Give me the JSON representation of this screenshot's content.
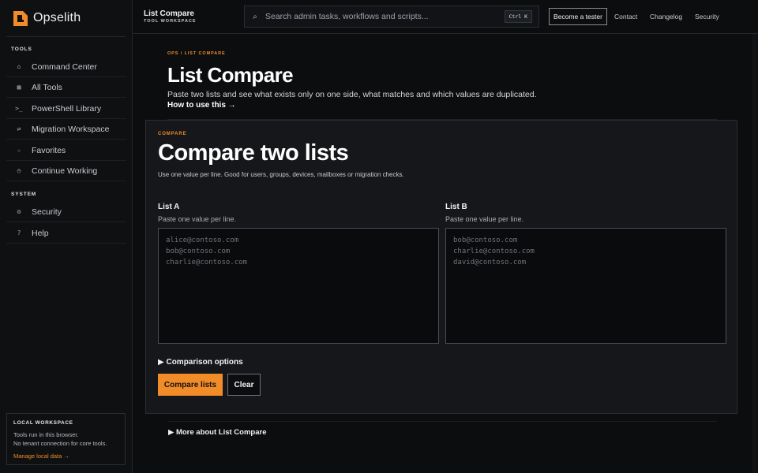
{
  "brand": {
    "name": "Opselith"
  },
  "sidebar": {
    "tools_label": "TOOLS",
    "tools": [
      {
        "icon": "⌂",
        "label": "Command Center"
      },
      {
        "icon": "▦",
        "label": "All Tools"
      },
      {
        "icon": ">_",
        "label": "PowerShell Library"
      },
      {
        "icon": "⇄",
        "label": "Migration Workspace"
      },
      {
        "icon": "☆",
        "label": "Favorites"
      },
      {
        "icon": "◷",
        "label": "Continue Working"
      }
    ],
    "system_label": "SYSTEM",
    "system": [
      {
        "icon": "⚙",
        "label": "Security"
      },
      {
        "icon": "?",
        "label": "Help"
      }
    ],
    "local": {
      "title": "LOCAL WORKSPACE",
      "line1": "Tools run in this browser.",
      "line2": "No tenant connection for core tools.",
      "link": "Manage local data →"
    }
  },
  "header": {
    "tool_title": "List Compare",
    "tool_subtitle": "TOOL WORKSPACE",
    "search_placeholder": "Search admin tasks, workflows and scripts...",
    "search_shortcut": "Ctrl K",
    "tester_button": "Become a tester",
    "links": [
      "Contact",
      "Changelog",
      "Security"
    ]
  },
  "page": {
    "breadcrumb": "OPS / LIST COMPARE",
    "title": "List Compare",
    "description": "Paste two lists and see what exists only on one side, what matches and which values are duplicated.",
    "how_link": "How to use this →"
  },
  "card": {
    "kicker": "COMPARE",
    "title": "Compare two lists",
    "description": "Use one value per line. Good for users, groups, devices, mailboxes or migration checks.",
    "list_a": {
      "label": "List A",
      "hint": "Paste one value per line.",
      "placeholder": "alice@contoso.com\nbob@contoso.com\ncharlie@contoso.com",
      "value": ""
    },
    "list_b": {
      "label": "List B",
      "hint": "Paste one value per line.",
      "placeholder": "bob@contoso.com\ncharlie@contoso.com\ndavid@contoso.com",
      "value": ""
    },
    "options_toggle": "▶ Comparison options",
    "compare_button": "Compare lists",
    "clear_button": "Clear"
  },
  "more": {
    "toggle": "▶ More about List Compare"
  },
  "colors": {
    "accent": "#f28c28",
    "background": "#0c0d0f",
    "card": "#15171a"
  }
}
